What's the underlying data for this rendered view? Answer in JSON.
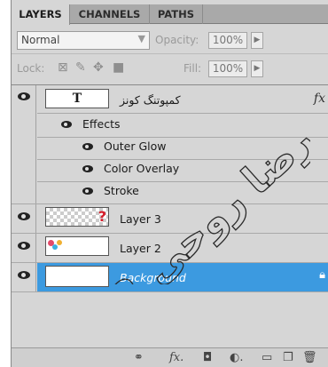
{
  "tabs": [
    "LAYERS",
    "CHANNELS",
    "PATHS"
  ],
  "blend_mode": "Normal",
  "opacity": {
    "label": "Opacity:",
    "value": "100%"
  },
  "lock_label": "Lock:",
  "fill": {
    "label": "Fill:",
    "value": "100%"
  },
  "layers": [
    {
      "name": "کمپوتنگ کونز",
      "thumb": "T",
      "fx": "fx"
    },
    {
      "name": "Effects"
    },
    {
      "name": "Outer Glow"
    },
    {
      "name": "Color Overlay"
    },
    {
      "name": "Stroke"
    },
    {
      "name": "Layer 3"
    },
    {
      "name": "Layer 2"
    },
    {
      "name": "Background"
    }
  ],
  "watermark": "رضا روحی 2",
  "colors": {
    "selection": "#3c9ae0",
    "panel": "#d6d6d6",
    "tabbar": "#a9a9a9"
  }
}
